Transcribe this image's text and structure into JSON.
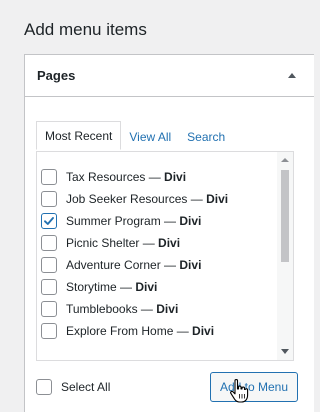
{
  "heading": "Add menu items",
  "panel": {
    "title": "Pages",
    "tabs": [
      {
        "label": "Most Recent",
        "active": true
      },
      {
        "label": "View All",
        "active": false
      },
      {
        "label": "Search",
        "active": false
      }
    ],
    "items": [
      {
        "title": "Tax Resources",
        "sep": " — ",
        "builder": "Divi",
        "checked": false
      },
      {
        "title": "Job Seeker Resources",
        "sep": " — ",
        "builder": "Divi",
        "checked": false
      },
      {
        "title": "Summer Program",
        "sep": " — ",
        "builder": "Divi",
        "checked": true
      },
      {
        "title": "Picnic Shelter",
        "sep": " — ",
        "builder": "Divi",
        "checked": false
      },
      {
        "title": "Adventure Corner",
        "sep": " — ",
        "builder": "Divi",
        "checked": false
      },
      {
        "title": "Storytime",
        "sep": " — ",
        "builder": "Divi",
        "checked": false
      },
      {
        "title": "Tumblebooks",
        "sep": " — ",
        "builder": "Divi",
        "checked": false
      },
      {
        "title": "Explore From Home",
        "sep": " — ",
        "builder": "Divi",
        "checked": false
      }
    ],
    "select_all_label": "Select All",
    "add_button_label": "Add to Menu"
  },
  "colors": {
    "accent": "#2271b1",
    "text": "#1d2327",
    "background": "#f0f0f1"
  },
  "icons": {
    "toggle": "caret-up-icon",
    "checkmark": "check-icon",
    "cursor": "hand-pointer-icon"
  }
}
